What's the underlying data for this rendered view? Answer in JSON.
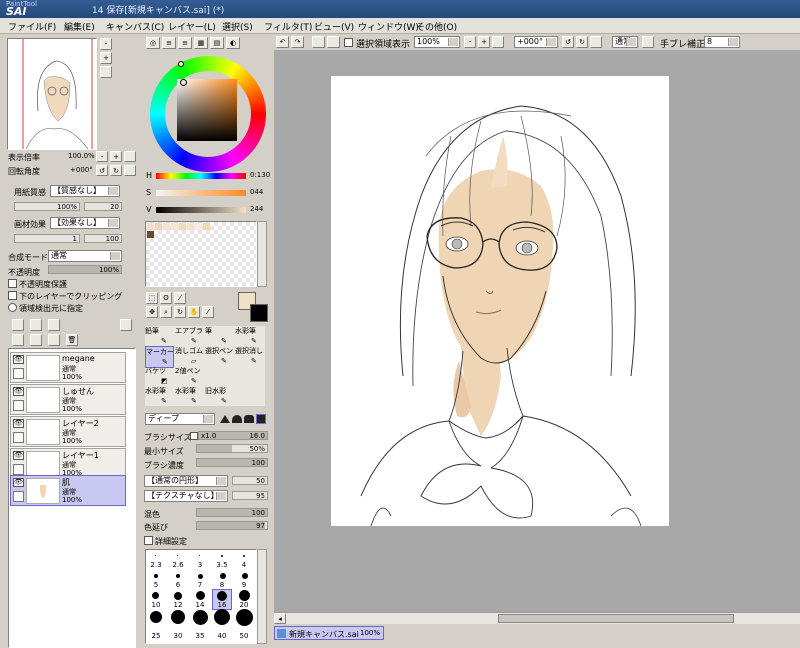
{
  "title": {
    "app_line1": "PaintTool",
    "app_line2": "SAI",
    "window_title": "14 保存[新規キャンバス.sai] (*)"
  },
  "menu": [
    "ファイル(F)",
    "編集(E)",
    "キャンバス(C)",
    "レイヤー(L)",
    "選択(S)",
    "フィルタ(T)",
    "ビュー(V)",
    "ウィンドウ(W)",
    "その他(O)"
  ],
  "navigator": {
    "zoom_label": "表示倍率",
    "zoom_value": "100.0%",
    "rotate_label": "回転角度",
    "rotate_value": "+000°"
  },
  "texture": {
    "paper_label": "用紙質感",
    "paper_value": "【質感なし】",
    "paper_scale": "100%",
    "paper_strength": "20",
    "effect_label": "画材効果",
    "effect_value": "【効果なし】",
    "effect_width": "1",
    "effect_strength": "100"
  },
  "blend": {
    "mode_label": "合成モード",
    "mode_value": "通常",
    "opacity_label": "不透明度",
    "opacity_value": "100%",
    "preserve_opacity": "不透明度保護",
    "clip_lower": "下のレイヤーでクリッピング",
    "selection_source": "領域検出元に指定"
  },
  "layers": [
    {
      "name": "megane",
      "mode": "通常",
      "opacity": "100%"
    },
    {
      "name": "しゅせん",
      "mode": "通常",
      "opacity": "100%"
    },
    {
      "name": "レイヤー2",
      "mode": "通常",
      "opacity": "100%"
    },
    {
      "name": "レイヤー1",
      "mode": "通常",
      "opacity": "100%"
    },
    {
      "name": "肌",
      "mode": "通常",
      "opacity": "100%"
    }
  ],
  "color": {
    "h_label": "H",
    "h_value": "0:130",
    "s_label": "S",
    "s_value": "044",
    "v_label": "V",
    "v_value": "244",
    "primary": "#f2dfc7",
    "hue_color": "#ff8a1e"
  },
  "tools": [
    {
      "label": "鉛筆"
    },
    {
      "label": "エアブラシ"
    },
    {
      "label": "筆"
    },
    {
      "label": "水彩筆"
    },
    {
      "label": "マーカー"
    },
    {
      "label": "消しゴム"
    },
    {
      "label": "選択ペン"
    },
    {
      "label": "選択消し"
    },
    {
      "label": "バケツ"
    },
    {
      "label": "2値ペン"
    },
    {
      "label": ""
    },
    {
      "label": ""
    },
    {
      "label": "水彩筆"
    },
    {
      "label": "水彩筆"
    },
    {
      "label": "旧水彩"
    },
    {
      "label": ""
    }
  ],
  "brush": {
    "edge_value": "ディープ",
    "size_label": "ブラシサイズ",
    "size_mult": "x1.0",
    "size_value": "16.0",
    "min_size_label": "最小サイズ",
    "min_size_value": "50%",
    "density_label": "ブラシ濃度",
    "density_value": "100",
    "shape_value": "【通常の円形】",
    "shape_strength": "50",
    "tex_value": "【テクスチャなし】",
    "tex_strength": "95",
    "blend_label": "混色",
    "blend_value": "100",
    "dilution_label": "色延び",
    "dilution_value": "97",
    "detail_label": "詳細設定"
  },
  "sizes": [
    [
      "",
      "",
      "",
      "",
      ""
    ],
    [
      "2.3",
      "2.6",
      "3",
      "3.5",
      "4"
    ],
    [
      "5",
      "6",
      "7",
      "8",
      "9"
    ],
    [
      "10",
      "12",
      "14",
      "16",
      "20"
    ],
    [
      "25",
      "30",
      "35",
      "40",
      "50"
    ]
  ],
  "toolbar": {
    "show_selection": "選択領域表示",
    "zoom": "100%",
    "rotate": "+000°",
    "blend": "通常",
    "stabilizer_label": "手ブレ補正",
    "stabilizer_value": "8"
  },
  "status": {
    "doc_name": "新規キャンバス.sai",
    "doc_zoom": "100%"
  }
}
